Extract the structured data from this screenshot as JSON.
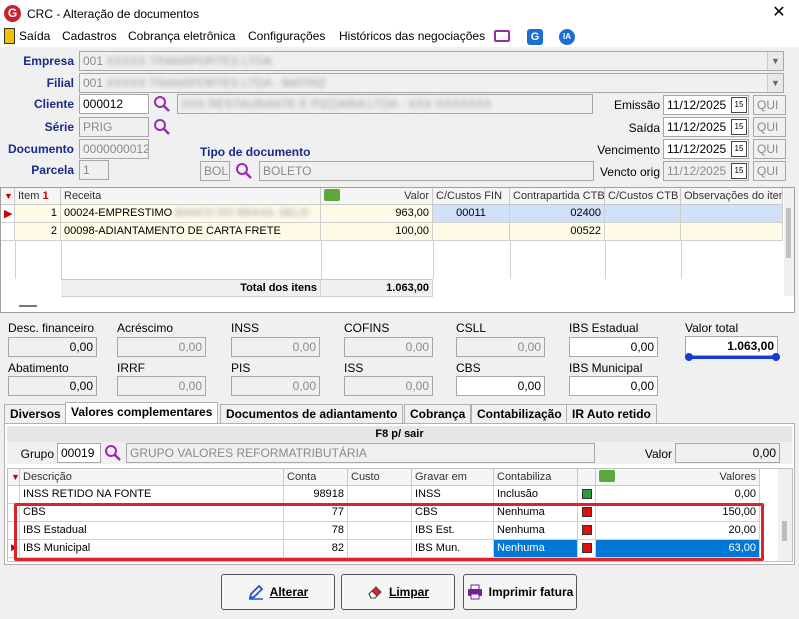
{
  "window": {
    "title": "CRC - Alteração de documentos",
    "close": "✕"
  },
  "menu": [
    "Saída",
    "Cadastros",
    "Cobrança eletrônica",
    "Configurações",
    "Históricos das negociações"
  ],
  "menu_icons": {
    "ia": "IA"
  },
  "header": {
    "empresa_label": "Empresa",
    "empresa_code": "001",
    "empresa_name": "XXXXX TRANSPORTES LTDA",
    "filial_label": "Filial",
    "filial_code": "001",
    "filial_name": "XXXXX TRANSPORTES LTDA - MATRIZ",
    "cliente_label": "Cliente",
    "cliente_code": "000012",
    "cliente_name": "XXX RESTAURANTE E PIZZARIA LTDA - XXX XXXXXXX",
    "serie_label": "Série",
    "serie_value": "PRIG",
    "documento_label": "Documento",
    "documento_value": "0000000012",
    "parcela_label": "Parcela",
    "parcela_value": "1",
    "tipo_label": "Tipo de documento",
    "tipo_code": "BOL",
    "tipo_name": "BOLETO",
    "emissao_label": "Emissão",
    "emissao_value": "11/12/2025",
    "emissao_day": "QUI",
    "saida_label": "Saída",
    "saida_value": "11/12/2025",
    "saida_day": "QUI",
    "vencimento_label": "Vencimento",
    "vencimento_value": "11/12/2025",
    "vencimento_day": "QUI",
    "vencto_orig_label": "Vencto orig",
    "vencto_orig_value": "11/12/2025",
    "vencto_orig_day": "QUI",
    "cal_glyph": "15"
  },
  "items_grid": {
    "headers": [
      "Item",
      "Receita",
      "Valor",
      "C/Custos FIN",
      "Contrapartida CTB",
      "C/Custos CTB",
      "Observações do item"
    ],
    "sort_marker": "1",
    "rows": [
      {
        "item": "1",
        "receita": "00024-EMPRESTIMO",
        "receita_blur": "BANCO DO BRASIL SELIC",
        "valor": "963,00",
        "ccfin": "00011",
        "contrapartida": "02400",
        "ccctb": "",
        "obs": ""
      },
      {
        "item": "2",
        "receita": "00098-ADIANTAMENTO DE CARTA FRETE",
        "receita_blur": "",
        "valor": "100,00",
        "ccfin": "",
        "contrapartida": "00522",
        "ccctb": "",
        "obs": ""
      }
    ],
    "total_label": "Total dos itens",
    "total_value": "1.063,00"
  },
  "totals": {
    "desc_fin_label": "Desc. financeiro",
    "desc_fin": "0,00",
    "acrescimo_label": "Acréscimo",
    "acrescimo": "0,00",
    "inss_label": "INSS",
    "inss": "0,00",
    "cofins_label": "COFINS",
    "cofins": "0,00",
    "csll_label": "CSLL",
    "csll": "0,00",
    "ibs_est_label": "IBS Estadual",
    "ibs_est": "0,00",
    "valor_total_label": "Valor total",
    "valor_total": "1.063,00",
    "abatimento_label": "Abatimento",
    "abatimento": "0,00",
    "irrf_label": "IRRF",
    "irrf": "0,00",
    "pis_label": "PIS",
    "pis": "0,00",
    "iss_label": "ISS",
    "iss": "0,00",
    "cbs_label": "CBS",
    "cbs": "0,00",
    "ibs_mun_label": "IBS Municipal",
    "ibs_mun": "0,00"
  },
  "tabs": [
    "Diversos",
    "Valores complementares",
    "Documentos de adiantamento",
    "Cobrança",
    "Contabilização",
    "IR Auto retido"
  ],
  "panel": {
    "hint": "F8 p/ sair",
    "grupo_label": "Grupo",
    "grupo_code": "00019",
    "grupo_name": "GRUPO VALORES REFORMATRIBUTÁRIA",
    "valor_label": "Valor",
    "valor_value": "0,00"
  },
  "values_grid": {
    "headers": [
      "Descrição",
      "Conta",
      "Custo",
      "Gravar em",
      "Contabiliza",
      "",
      "Valores"
    ],
    "rows": [
      {
        "descricao": "INSS RETIDO NA FONTE",
        "conta": "98918",
        "custo": "",
        "gravar": "INSS",
        "contabiliza": "Inclusão",
        "flag": "#2a9a3a",
        "valor": "0,00"
      },
      {
        "descricao": "CBS",
        "conta": "77",
        "custo": "",
        "gravar": "CBS",
        "contabiliza": "Nenhuma",
        "flag": "#e01010",
        "valor": "150,00"
      },
      {
        "descricao": "IBS Estadual",
        "conta": "78",
        "custo": "",
        "gravar": "IBS Est.",
        "contabiliza": "Nenhuma",
        "flag": "#e01010",
        "valor": "20,00"
      },
      {
        "descricao": "IBS Municipal",
        "conta": "82",
        "custo": "",
        "gravar": "IBS Mun.",
        "contabiliza": "Nenhuma",
        "flag": "#e01010",
        "valor": "63,00"
      }
    ]
  },
  "buttons": {
    "alterar": "Alterar",
    "limpar": "Limpar",
    "imprimir": "Imprimir fatura"
  },
  "colors": {
    "label_blue": "#1a2a8a",
    "selection": "#0078d7",
    "row_highlight": "#cfe0f7",
    "highlight_box": "#d8242a",
    "brand_red": "#c8202d"
  }
}
